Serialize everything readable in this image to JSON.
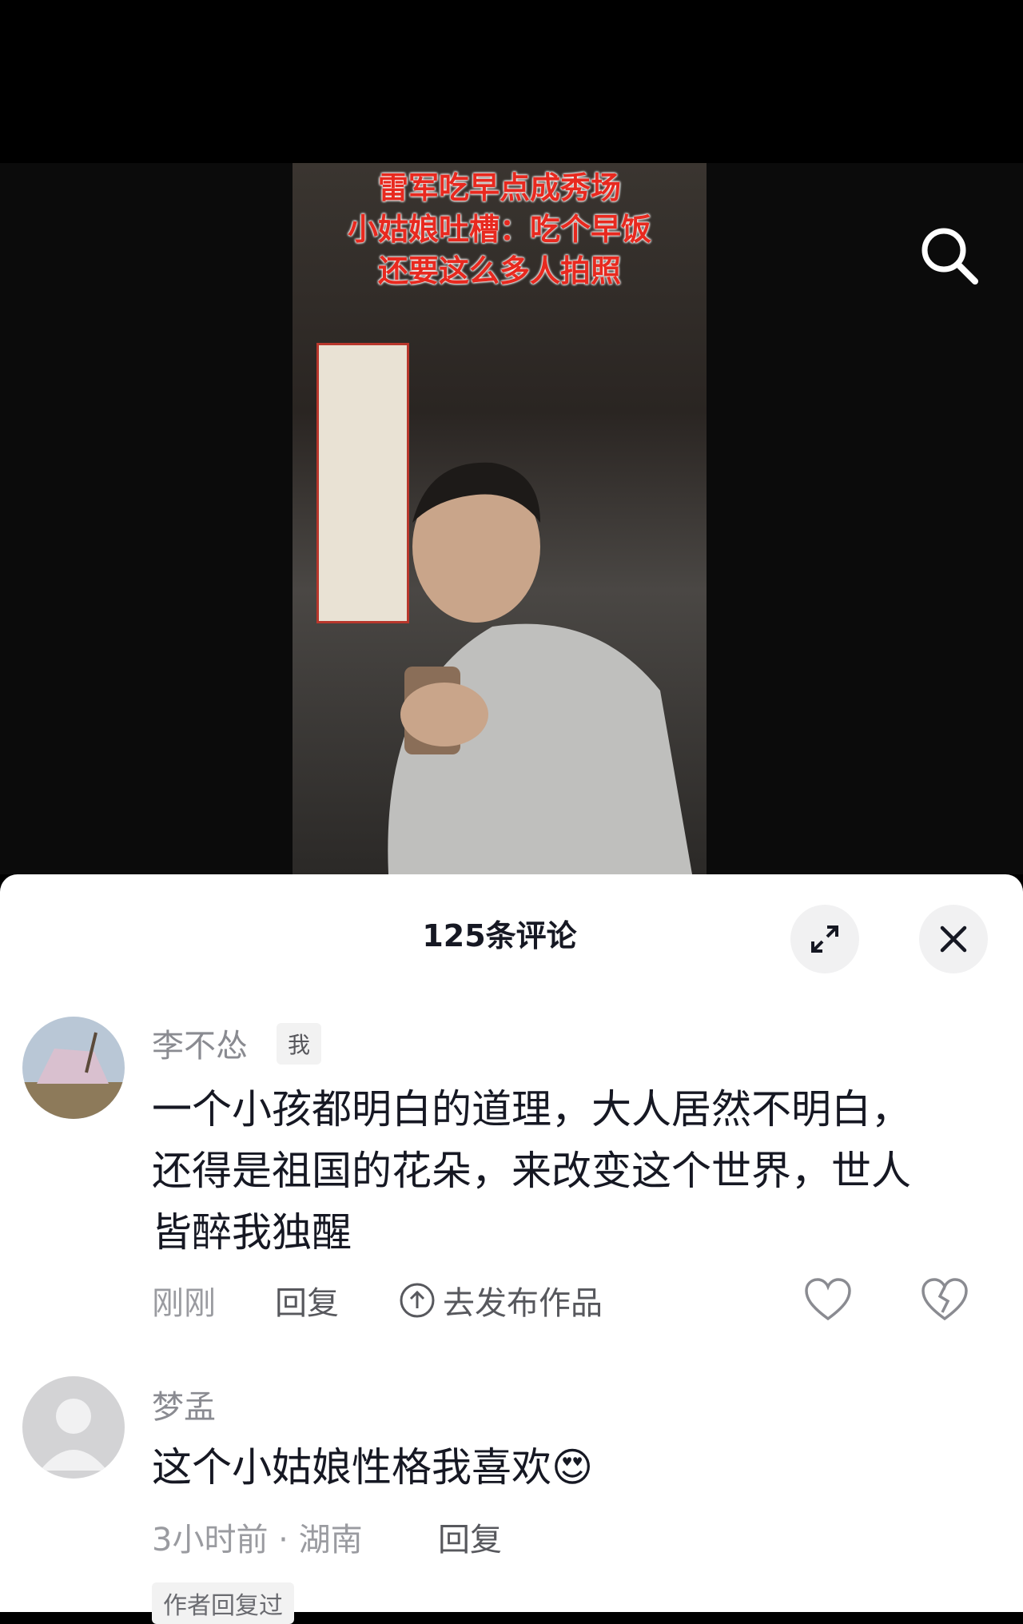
{
  "video": {
    "caption_lines": [
      "雷军吃早点成秀场",
      "小姑娘吐槽：吃个早饭",
      "还要这么多人拍照"
    ]
  },
  "comments_sheet": {
    "title": "125条评论",
    "comments": [
      {
        "username": "李不怂",
        "badge": "我",
        "text": "一个小孩都明白的道理，大人居然不明白，还得是祖国的花朵，来改变这个世界，世人皆醉我独醒",
        "time": "刚刚",
        "reply_label": "回复",
        "publish_label": "去发布作品"
      },
      {
        "username": "梦孟",
        "text": "这个小姑娘性格我喜欢",
        "emoji": "😍",
        "time": "3小时前 · 湖南",
        "reply_label": "回复",
        "author_replied_label": "作者回复过"
      }
    ]
  },
  "icons": [
    "search-icon",
    "expand-icon",
    "close-icon",
    "upload-icon",
    "like-icon",
    "dislike-icon",
    "emoji-heart-eyes-icon"
  ]
}
